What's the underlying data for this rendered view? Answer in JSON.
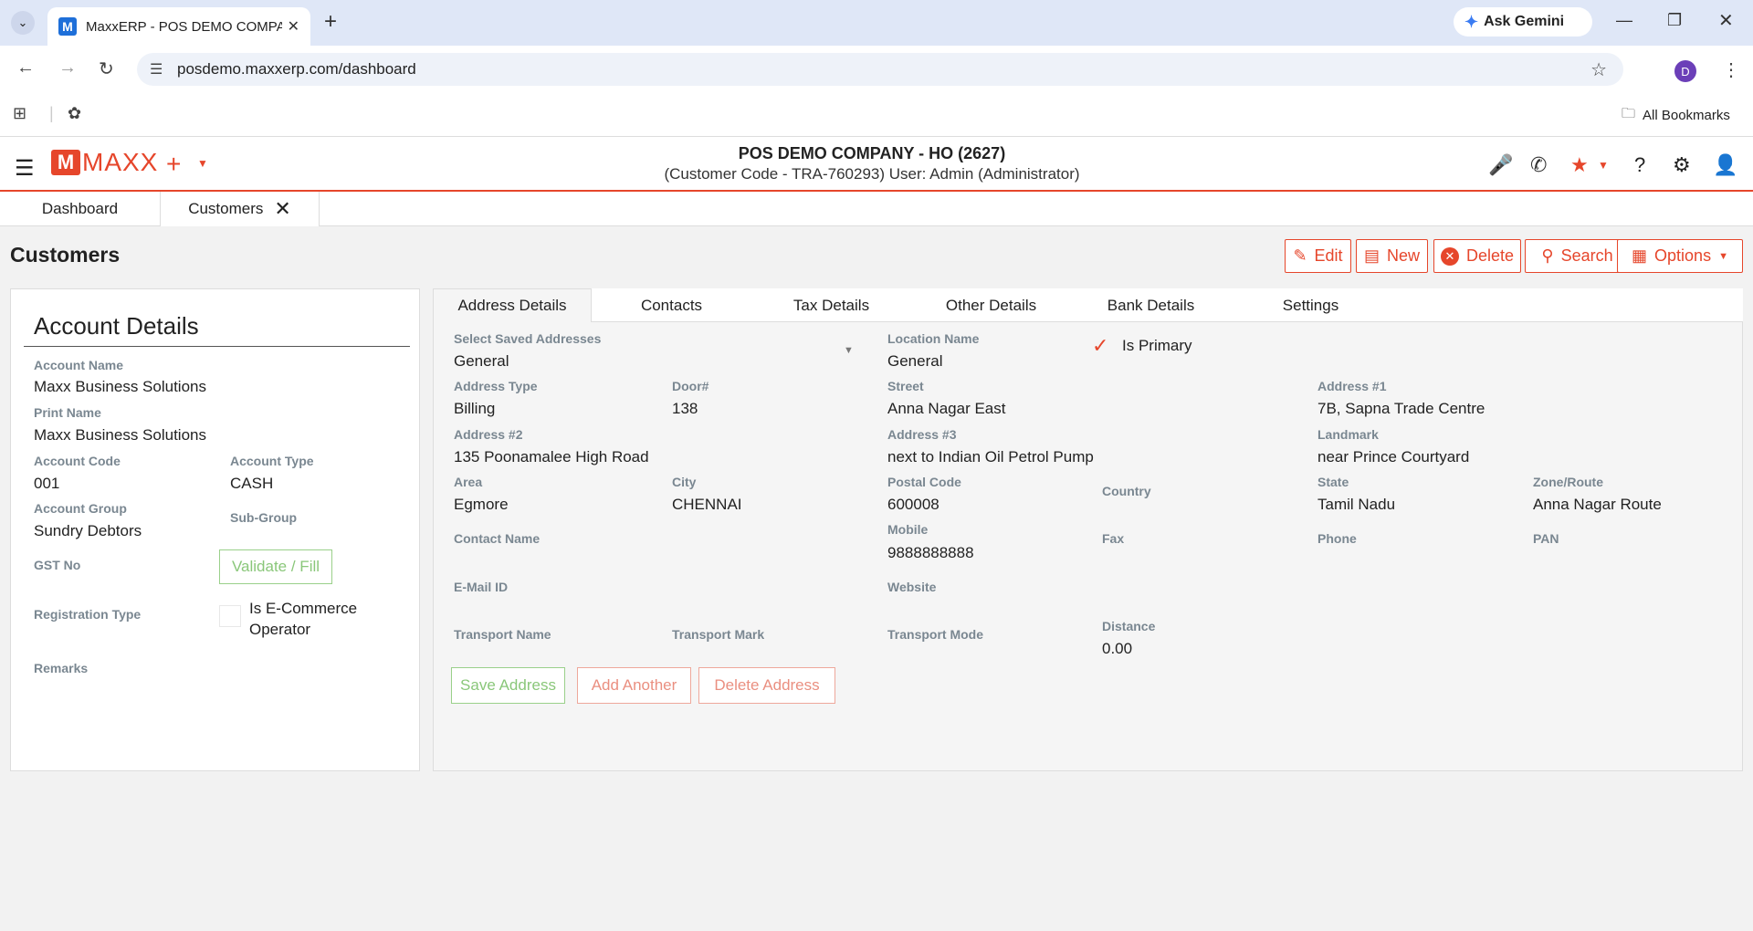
{
  "browser": {
    "tab_title": "MaxxERP - POS DEMO COMPAN",
    "tab_close": "✕",
    "new_tab": "+",
    "ask_gemini": "Ask Gemini",
    "url": "posdemo.maxxerp.com/dashboard",
    "profile_initial": "D",
    "all_bookmarks": "All Bookmarks"
  },
  "app": {
    "logo_letter": "M",
    "logo_text": "MAXX",
    "company_line1": "POS DEMO COMPANY - HO (2627)",
    "company_line2": "(Customer Code - TRA-760293) User: Admin (Administrator)",
    "accent": "#e6462b"
  },
  "page_tabs": [
    {
      "label": "Dashboard"
    },
    {
      "label": "Customers"
    }
  ],
  "page_title": "Customers",
  "toolbar": {
    "edit": "Edit",
    "new": "New",
    "delete": "Delete",
    "search": "Search",
    "options": "Options"
  },
  "account": {
    "title": "Account Details",
    "account_name_label": "Account Name",
    "account_name": "Maxx Business Solutions",
    "print_name_label": "Print Name",
    "print_name": "Maxx Business Solutions",
    "account_code_label": "Account Code",
    "account_code": "001",
    "account_type_label": "Account Type",
    "account_type": "CASH",
    "account_group_label": "Account Group",
    "account_group": "Sundry Debtors",
    "sub_group_label": "Sub-Group",
    "gst_label": "GST No",
    "validate_btn": "Validate / Fill",
    "registration_label": "Registration Type",
    "ecommerce_label_1": "Is E-Commerce",
    "ecommerce_label_2": "Operator",
    "remarks_label": "Remarks"
  },
  "detail_tabs": [
    "Address Details",
    "Contacts",
    "Tax Details",
    "Other Details",
    "Bank Details",
    "Settings"
  ],
  "address": {
    "saved_label": "Select Saved Addresses",
    "saved_value": "General",
    "location_label": "Location Name",
    "location_value": "General",
    "is_primary": "Is Primary",
    "address_type_label": "Address Type",
    "address_type": "Billing",
    "door_label": "Door#",
    "door": "138",
    "street_label": "Street",
    "street": "Anna Nagar East",
    "addr1_label": "Address #1",
    "addr1": "7B, Sapna Trade Centre",
    "addr2_label": "Address #2",
    "addr2": "135 Poonamalee High Road",
    "addr3_label": "Address #3",
    "addr3": "next to Indian Oil Petrol Pump",
    "landmark_label": "Landmark",
    "landmark": "near Prince Courtyard",
    "area_label": "Area",
    "area": "Egmore",
    "city_label": "City",
    "city": "CHENNAI",
    "postal_label": "Postal Code",
    "postal": "600008",
    "country_label": "Country",
    "state_label": "State",
    "state": "Tamil Nadu",
    "zone_label": "Zone/Route",
    "zone": "Anna Nagar Route",
    "contact_label": "Contact Name",
    "mobile_label": "Mobile",
    "mobile": "9888888888",
    "fax_label": "Fax",
    "phone_label": "Phone",
    "pan_label": "PAN",
    "email_label": "E-Mail ID",
    "website_label": "Website",
    "transport_name_label": "Transport Name",
    "transport_mark_label": "Transport Mark",
    "transport_mode_label": "Transport Mode",
    "distance_label": "Distance",
    "distance": "0.00",
    "save_btn": "Save Address",
    "add_btn": "Add Another",
    "delete_btn": "Delete Address"
  }
}
